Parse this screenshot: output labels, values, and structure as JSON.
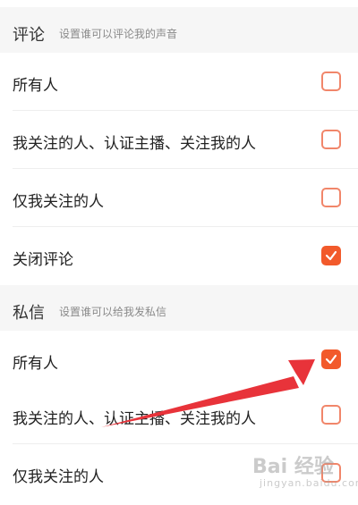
{
  "comments": {
    "title": "评论",
    "description": "设置谁可以评论我的声音",
    "options": [
      {
        "label": "所有人",
        "checked": false
      },
      {
        "label": "我关注的人、认证主播、关注我的人",
        "checked": false
      },
      {
        "label": "仅我关注的人",
        "checked": false
      },
      {
        "label": "关闭评论",
        "checked": true
      }
    ]
  },
  "messages": {
    "title": "私信",
    "description": "设置谁可以给我发私信",
    "options": [
      {
        "label": "所有人",
        "checked": true
      },
      {
        "label": "我关注的人、认证主播、关注我的人",
        "checked": false
      },
      {
        "label": "仅我关注的人",
        "checked": false
      }
    ]
  },
  "watermark": {
    "logo": "Bai 经验",
    "url": "jingyan.baidu.com"
  },
  "colors": {
    "accent": "#f25a2b",
    "checkbox_border": "#f1866a",
    "arrow": "#e8333a"
  }
}
